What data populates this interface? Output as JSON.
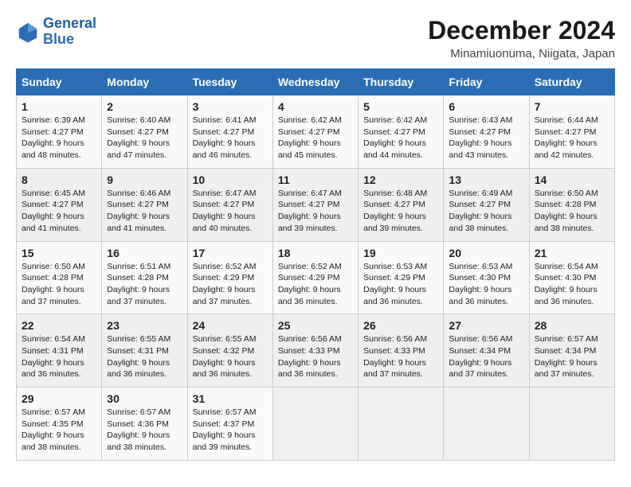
{
  "logo": {
    "line1": "General",
    "line2": "Blue"
  },
  "title": "December 2024",
  "subtitle": "Minamiuonuma, Niigata, Japan",
  "days_of_week": [
    "Sunday",
    "Monday",
    "Tuesday",
    "Wednesday",
    "Thursday",
    "Friday",
    "Saturday"
  ],
  "weeks": [
    [
      {
        "day": "1",
        "sunrise": "Sunrise: 6:39 AM",
        "sunset": "Sunset: 4:27 PM",
        "daylight": "Daylight: 9 hours and 48 minutes."
      },
      {
        "day": "2",
        "sunrise": "Sunrise: 6:40 AM",
        "sunset": "Sunset: 4:27 PM",
        "daylight": "Daylight: 9 hours and 47 minutes."
      },
      {
        "day": "3",
        "sunrise": "Sunrise: 6:41 AM",
        "sunset": "Sunset: 4:27 PM",
        "daylight": "Daylight: 9 hours and 46 minutes."
      },
      {
        "day": "4",
        "sunrise": "Sunrise: 6:42 AM",
        "sunset": "Sunset: 4:27 PM",
        "daylight": "Daylight: 9 hours and 45 minutes."
      },
      {
        "day": "5",
        "sunrise": "Sunrise: 6:42 AM",
        "sunset": "Sunset: 4:27 PM",
        "daylight": "Daylight: 9 hours and 44 minutes."
      },
      {
        "day": "6",
        "sunrise": "Sunrise: 6:43 AM",
        "sunset": "Sunset: 4:27 PM",
        "daylight": "Daylight: 9 hours and 43 minutes."
      },
      {
        "day": "7",
        "sunrise": "Sunrise: 6:44 AM",
        "sunset": "Sunset: 4:27 PM",
        "daylight": "Daylight: 9 hours and 42 minutes."
      }
    ],
    [
      {
        "day": "8",
        "sunrise": "Sunrise: 6:45 AM",
        "sunset": "Sunset: 4:27 PM",
        "daylight": "Daylight: 9 hours and 41 minutes."
      },
      {
        "day": "9",
        "sunrise": "Sunrise: 6:46 AM",
        "sunset": "Sunset: 4:27 PM",
        "daylight": "Daylight: 9 hours and 41 minutes."
      },
      {
        "day": "10",
        "sunrise": "Sunrise: 6:47 AM",
        "sunset": "Sunset: 4:27 PM",
        "daylight": "Daylight: 9 hours and 40 minutes."
      },
      {
        "day": "11",
        "sunrise": "Sunrise: 6:47 AM",
        "sunset": "Sunset: 4:27 PM",
        "daylight": "Daylight: 9 hours and 39 minutes."
      },
      {
        "day": "12",
        "sunrise": "Sunrise: 6:48 AM",
        "sunset": "Sunset: 4:27 PM",
        "daylight": "Daylight: 9 hours and 39 minutes."
      },
      {
        "day": "13",
        "sunrise": "Sunrise: 6:49 AM",
        "sunset": "Sunset: 4:27 PM",
        "daylight": "Daylight: 9 hours and 38 minutes."
      },
      {
        "day": "14",
        "sunrise": "Sunrise: 6:50 AM",
        "sunset": "Sunset: 4:28 PM",
        "daylight": "Daylight: 9 hours and 38 minutes."
      }
    ],
    [
      {
        "day": "15",
        "sunrise": "Sunrise: 6:50 AM",
        "sunset": "Sunset: 4:28 PM",
        "daylight": "Daylight: 9 hours and 37 minutes."
      },
      {
        "day": "16",
        "sunrise": "Sunrise: 6:51 AM",
        "sunset": "Sunset: 4:28 PM",
        "daylight": "Daylight: 9 hours and 37 minutes."
      },
      {
        "day": "17",
        "sunrise": "Sunrise: 6:52 AM",
        "sunset": "Sunset: 4:29 PM",
        "daylight": "Daylight: 9 hours and 37 minutes."
      },
      {
        "day": "18",
        "sunrise": "Sunrise: 6:52 AM",
        "sunset": "Sunset: 4:29 PM",
        "daylight": "Daylight: 9 hours and 36 minutes."
      },
      {
        "day": "19",
        "sunrise": "Sunrise: 6:53 AM",
        "sunset": "Sunset: 4:29 PM",
        "daylight": "Daylight: 9 hours and 36 minutes."
      },
      {
        "day": "20",
        "sunrise": "Sunrise: 6:53 AM",
        "sunset": "Sunset: 4:30 PM",
        "daylight": "Daylight: 9 hours and 36 minutes."
      },
      {
        "day": "21",
        "sunrise": "Sunrise: 6:54 AM",
        "sunset": "Sunset: 4:30 PM",
        "daylight": "Daylight: 9 hours and 36 minutes."
      }
    ],
    [
      {
        "day": "22",
        "sunrise": "Sunrise: 6:54 AM",
        "sunset": "Sunset: 4:31 PM",
        "daylight": "Daylight: 9 hours and 36 minutes."
      },
      {
        "day": "23",
        "sunrise": "Sunrise: 6:55 AM",
        "sunset": "Sunset: 4:31 PM",
        "daylight": "Daylight: 9 hours and 36 minutes."
      },
      {
        "day": "24",
        "sunrise": "Sunrise: 6:55 AM",
        "sunset": "Sunset: 4:32 PM",
        "daylight": "Daylight: 9 hours and 36 minutes."
      },
      {
        "day": "25",
        "sunrise": "Sunrise: 6:56 AM",
        "sunset": "Sunset: 4:33 PM",
        "daylight": "Daylight: 9 hours and 36 minutes."
      },
      {
        "day": "26",
        "sunrise": "Sunrise: 6:56 AM",
        "sunset": "Sunset: 4:33 PM",
        "daylight": "Daylight: 9 hours and 37 minutes."
      },
      {
        "day": "27",
        "sunrise": "Sunrise: 6:56 AM",
        "sunset": "Sunset: 4:34 PM",
        "daylight": "Daylight: 9 hours and 37 minutes."
      },
      {
        "day": "28",
        "sunrise": "Sunrise: 6:57 AM",
        "sunset": "Sunset: 4:34 PM",
        "daylight": "Daylight: 9 hours and 37 minutes."
      }
    ],
    [
      {
        "day": "29",
        "sunrise": "Sunrise: 6:57 AM",
        "sunset": "Sunset: 4:35 PM",
        "daylight": "Daylight: 9 hours and 38 minutes."
      },
      {
        "day": "30",
        "sunrise": "Sunrise: 6:57 AM",
        "sunset": "Sunset: 4:36 PM",
        "daylight": "Daylight: 9 hours and 38 minutes."
      },
      {
        "day": "31",
        "sunrise": "Sunrise: 6:57 AM",
        "sunset": "Sunset: 4:37 PM",
        "daylight": "Daylight: 9 hours and 39 minutes."
      },
      null,
      null,
      null,
      null
    ]
  ]
}
